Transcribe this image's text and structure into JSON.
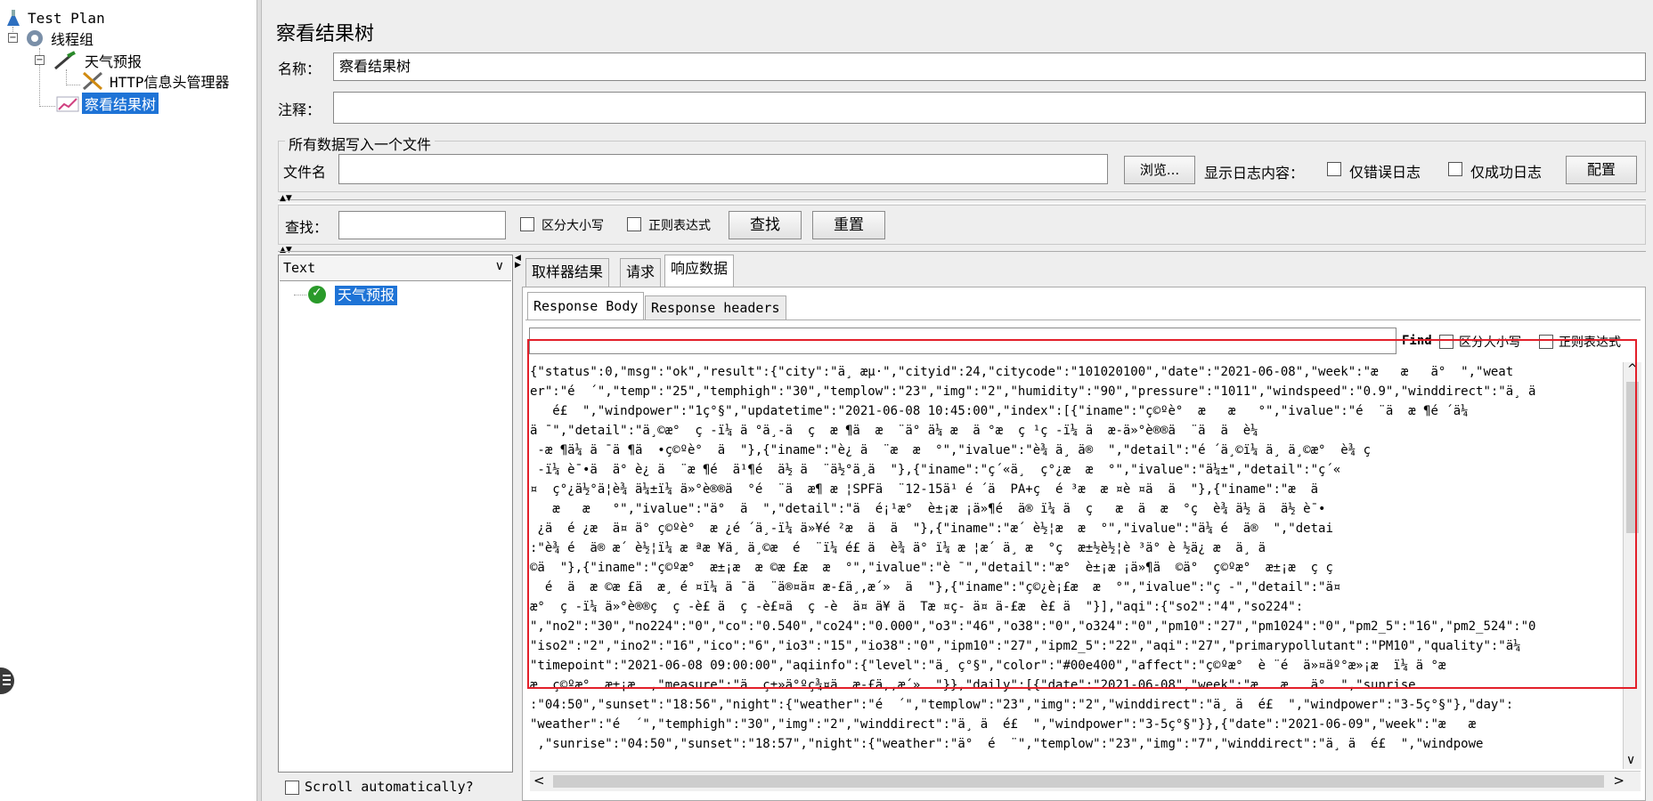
{
  "tree": {
    "root": "Test Plan",
    "thread_group": "线程组",
    "sampler": "天气预报",
    "header_manager": "HTTP信息头管理器",
    "listener": "察看结果树"
  },
  "panel": {
    "title": "察看结果树",
    "name_label": "名称：",
    "name_value": "察看结果树",
    "comment_label": "注释：",
    "comment_value": "",
    "file_group_title": "所有数据写入一个文件",
    "filename_label": "文件名",
    "filename_value": "",
    "browse_button": "浏览...",
    "log_label": "显示日志内容：",
    "errors_only": "仅错误日志",
    "success_only": "仅成功日志",
    "configure_button": "配置"
  },
  "search": {
    "label": "查找：",
    "value": "",
    "case_sensitive": "区分大小写",
    "regex": "正则表达式",
    "find_button": "查找",
    "reset_button": "重置"
  },
  "results": {
    "renderer": "Text",
    "items": [
      "天气预报"
    ],
    "scroll_auto": "Scroll automatically?"
  },
  "tabs": {
    "sampler_result": "取样器结果",
    "request": "请求",
    "response_data": "响应数据"
  },
  "subtabs": {
    "response_body": "Response Body",
    "response_headers": "Response headers"
  },
  "find": {
    "label": "Find",
    "case_sensitive": "区分大小写",
    "regex": "正则表达式"
  },
  "response_lines": [
    "{\"status\":0,\"msg\":\"ok\",\"result\":{\"city\":\"ä¸ æµ·\",\"cityid\":24,\"citycode\":\"101020100\",\"date\":\"2021-06-08\",\"week\":\"æ   æ   ä°  \",\"weat",
    "er\":\"é  ´\",\"temp\":\"25\",\"temphigh\":\"30\",\"templow\":\"23\",\"img\":\"2\",\"humidity\":\"90\",\"pressure\":\"1011\",\"windspeed\":\"0.9\",\"winddirect\":\"ä¸ ä",
    "   é£  \",\"windpower\":\"1ç°§\",\"updatetime\":\"2021-06-08 10:45:00\",\"index\":[{\"iname\":\"ç©ºè°  æ   æ   °\",\"ivalue\":\"é  ¨ä  æ ¶é ´ä¼",
    "ä ¯\",\"detail\":\"ä¸©æ°  ç -ï¼ ä °ä¸-ä  ç  æ ¶ä  æ  ¨ä° ä¼ æ  ä °æ  ç ¹ç -ï¼ ä  æ-ä»°è®®ä  ¨ä  ä  è¼",
    " -æ ¶ä¼ ä ¯ä ¶ä  •ç©ºè°  ä  \"},{\"iname\":\"è¿ ä  ¨æ  æ  °\",\"ivalue\":\"è¾ ä¸ ä®  \",\"detail\":\"é ´ä¸©ï¼ ä¸ ä¸©æ°  è¾ ç",
    " -ï¼ è¯•ä  ä° è¿ ä  ¨æ ¶é  ä¹¶é  ä½ ä  ¨ä½°ä¸ä  \"},{\"iname\":\"ç´«ä¸  ç°¿æ  æ  °\",\"ivalue\":\"ä¼±\",\"detail\":\"ç´«",
    "¤  ç°¿ä½°ä¦è¾ ä¼±ï¼ ä»°è®®ä  °é  ¨ä  æ¶ æ ¦SPFä  ¨12-15ä¹ é ´ä  PA+ç  é ³æ  æ ¤è ¤ä  ä  \"},{\"iname\":\"æ  ä",
    "   æ   æ   °\",\"ivalue\":\"ä°  ä  \",\"detail\":\"ä  é¡¹æ°  è±¡æ ¡ä»¶é  ä® ï¼ ä  ç   æ  ä  æ  °ç  è¾ ä½ ä  ä½ è¯•",
    " ¿ä  é ¿æ  ä¤ ä° ç©ºè°  æ ¿é ´ä¸-ï¼ ä»¥é ²æ  ä  ä  \"},{\"iname\":\"æ´ è½¦æ  æ  °\",\"ivalue\":\"ä¼ é  ä®  \",\"detai",
    ":\"è¾ é  ä® æ´ è½¦ï¼ æ ªæ ¥ä¸ ä¸©æ  é  ¨ï¼ é£ ä  è¾ ä° ï¼ æ ¦æ´ ä¸ æ  °ç  æ±½è½¦è ³ä° è ½ä¿ æ  ä¸ ä",
    "©ä  \"},{\"iname\":\"ç©ºæ°  æ±¡æ  æ ©æ £æ  æ  °\",\"ivalue\":\"è ¯\",\"detail\":\"æ°  è±¡æ ¡ä»¶ä  ©ä°  ç©ºæ°  æ±¡æ  ç ç",
    "  é  ä  æ ©æ £ä  æ¸ é ¤ï¼ ä ¯ä  ¨ä®¤ä¤ æ-£ä¸,æ´»  ä  \"},{\"iname\":\"ç©¿è¡£æ  æ  °\",\"ivalue\":\"ç -\",\"detail\":\"ä¤",
    "æ°  ç -ï¼ ä»°è®®ç  ç -è£ ä  ç -è£¤ä  ç -è  ä¤ ä¥ ä  Tæ ¤ç- ä¤ ä-£æ  è£ ä  \"}],\"aqi\":{\"so2\":\"4\",\"so224\":",
    "\",\"no2\":\"30\",\"no224\":\"0\",\"co\":\"0.540\",\"co24\":\"0.000\",\"o3\":\"46\",\"o38\":\"0\",\"o324\":\"0\",\"pm10\":\"27\",\"pm1024\":\"0\",\"pm2_5\":\"16\",\"pm2_524\":\"0",
    "\"iso2\":\"2\",\"ino2\":\"16\",\"ico\":\"6\",\"io3\":\"15\",\"io38\":\"0\",\"ipm10\":\"27\",\"ipm2_5\":\"22\",\"aqi\":\"27\",\"primarypollutant\":\"PM10\",\"quality\":\"ä¼",
    "\"timepoint\":\"2021-06-08 09:00:00\",\"aqiinfo\":{\"level\":\"ä¸ ç°§\",\"color\":\"#00e400\",\"affect\":\"ç©ºæ°  è ¨é  ä»¤äº°æ»¡æ  ï¼ ä °æ",
    "æ  ç©ºæ°  æ±¡æ  ,\"measure\":\"ä  ç±»ä°ºç¾¤ä  æ-£ä,,æ´»  \"}},\"daily\":[{\"date\":\"2021-06-08\",\"week\":\"æ   æ   ä°  \",\"sunrise",
    ":\"04:50\",\"sunset\":\"18:56\",\"night\":{\"weather\":\"é  ´\",\"templow\":\"23\",\"img\":\"2\",\"winddirect\":\"ä¸ ä  é£  \",\"windpower\":\"3-5ç°§\"},\"day\":",
    "\"weather\":\"é  ´\",\"temphigh\":\"30\",\"img\":\"2\",\"winddirect\":\"ä¸ ä  é£  \",\"windpower\":\"3-5ç°§\"}},{\"date\":\"2021-06-09\",\"week\":\"æ   æ",
    " ,\"sunrise\":\"04:50\",\"sunset\":\"18:57\",\"night\":{\"weather\":\"ä°  é  ¨\",\"templow\":\"23\",\"img\":\"7\",\"winddirect\":\"ä¸ ä  é£  \",\"windpowe"
  ],
  "colors": {
    "selection": "#1e73d6",
    "highlight_box": "#e3202a",
    "success_icon": "#2a9a2a"
  }
}
